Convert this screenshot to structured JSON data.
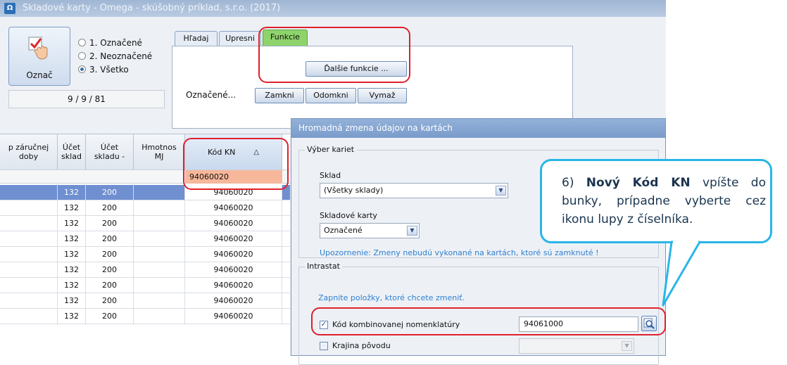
{
  "window": {
    "icon_glyph": "Ω",
    "title": "Skladové karty - Omega - skúšobný príklad, s.r.o. (2017)"
  },
  "mark": {
    "button_label": "Označ",
    "icon": "checkmark-hand-icon",
    "options": [
      "1. Označené",
      "2. Neoznačené",
      "3. Všetko"
    ],
    "selected_index": 2,
    "counter": "9 / 9 / 81"
  },
  "tabs": [
    "Hľadaj",
    "Upresni",
    "Funkcie"
  ],
  "functions": {
    "more_button": "Ďalšie funkcie ...",
    "marked_label": "Označené...",
    "buttons": [
      "Zamkni",
      "Odomkni",
      "Vymaž"
    ]
  },
  "grid": {
    "headers": [
      "p záručnej\ndoby",
      "Účet\nsklad",
      "Účet\nskladu -",
      "Hmotnos\nMJ",
      "Kód KN"
    ],
    "sort_icon": "△",
    "filter_kod": "94060020",
    "rows": [
      {
        "ucet_sklad": "132",
        "ucet_skladu": "200",
        "kod": "94060020",
        "selected": true
      },
      {
        "ucet_sklad": "132",
        "ucet_skladu": "200",
        "kod": "94060020"
      },
      {
        "ucet_sklad": "132",
        "ucet_skladu": "200",
        "kod": "94060020"
      },
      {
        "ucet_sklad": "132",
        "ucet_skladu": "200",
        "kod": "94060020"
      },
      {
        "ucet_sklad": "132",
        "ucet_skladu": "200",
        "kod": "94060020"
      },
      {
        "ucet_sklad": "132",
        "ucet_skladu": "200",
        "kod": "94060020"
      },
      {
        "ucet_sklad": "132",
        "ucet_skladu": "200",
        "kod": "94060020"
      },
      {
        "ucet_sklad": "132",
        "ucet_skladu": "200",
        "kod": "94060020"
      },
      {
        "ucet_sklad": "132",
        "ucet_skladu": "200",
        "kod": "94060020"
      }
    ]
  },
  "dialog": {
    "title": "Hromadná zmena údajov na kartách",
    "selection_group": "Výber kariet",
    "sklad_label": "Sklad",
    "sklad_value": "(Všetky sklady)",
    "karty_label": "Skladové karty",
    "karty_value": "Označené",
    "warning": "Upozornenie: Zmeny nebudú vykonané na kartách, ktoré sú zamknuté !",
    "intrastat_group": "Intrastat",
    "intrastat_hint": "Zapnite položky, ktoré chcete zmeniť.",
    "kn_label": "Kód kombinovanej nomenklatúry",
    "kn_checked": true,
    "kn_value": "94061000",
    "origin_label": "Krajina pôvodu",
    "origin_checked": false
  },
  "callout": {
    "prefix": "6) ",
    "bold": "Nový Kód KN",
    "rest": " vpíšte do bunky, prípadne vyberte cez ikonu lupy z číselníka."
  },
  "colors": {
    "highlight_ring": "#e0202b",
    "callout_border": "#2ab5e8",
    "active_tab": "#8fd36d",
    "filter_cell": "#f7b79a",
    "selected_row": "#6f8fd1"
  }
}
